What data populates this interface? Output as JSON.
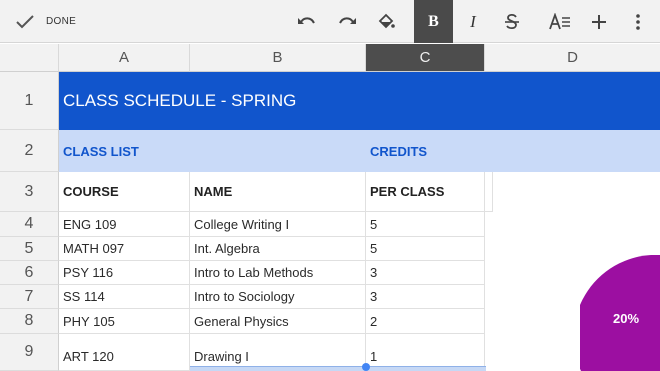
{
  "toolbar": {
    "done_label": "DONE",
    "bold_glyph": "B",
    "italic_glyph": "I"
  },
  "columns": [
    "A",
    "B",
    "C",
    "D"
  ],
  "rows": [
    "1",
    "2",
    "3",
    "4",
    "5",
    "6",
    "7",
    "8",
    "9"
  ],
  "sheet": {
    "title": "CLASS SCHEDULE - SPRING",
    "section_left": "CLASS LIST",
    "section_right": "CREDITS",
    "headers": [
      "COURSE",
      "NAME",
      "PER CLASS"
    ],
    "data": [
      [
        "ENG 109",
        "College Writing I",
        "5"
      ],
      [
        "MATH 097",
        "Int. Algebra",
        "5"
      ],
      [
        "PSY 116",
        "Intro to Lab Methods",
        "3"
      ],
      [
        "SS 114",
        "Intro to Sociology",
        "3"
      ],
      [
        "PHY 105",
        "General Physics",
        "2"
      ],
      [
        "ART 120",
        "Drawing I",
        "1"
      ]
    ]
  },
  "chart": {
    "slice_label": "20%",
    "slice_color": "#9c0fa1"
  },
  "colors": {
    "title_band": "#1155cc",
    "subheader_band": "#c9daf8",
    "selected_header": "#4d4d4d"
  }
}
